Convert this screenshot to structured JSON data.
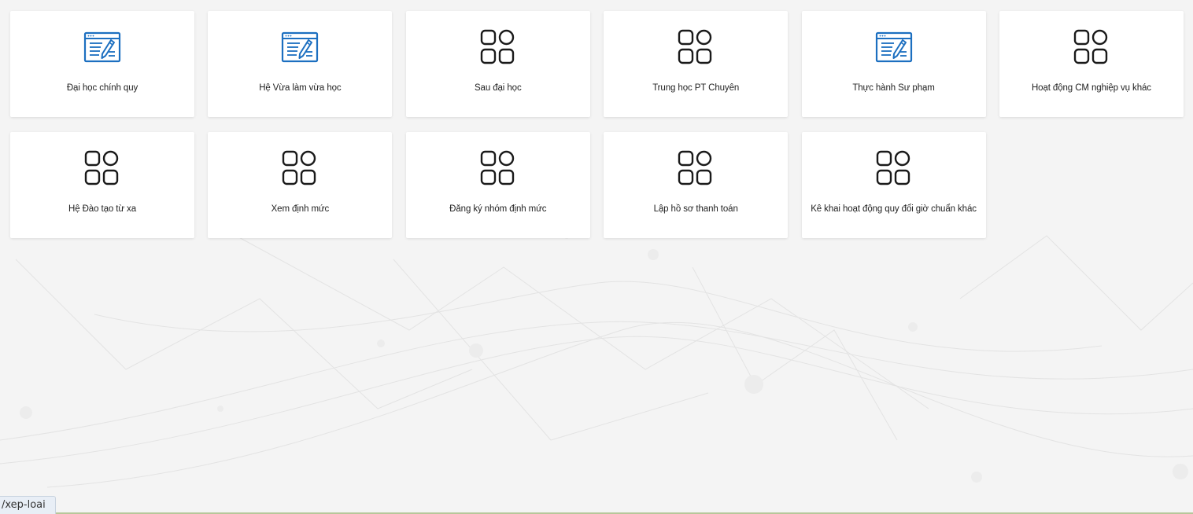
{
  "tiles": [
    {
      "label": "Đại học chính quy",
      "icon": "edit-document-icon"
    },
    {
      "label": "Hệ Vừa làm vừa học",
      "icon": "edit-document-icon"
    },
    {
      "label": "Sau đại học",
      "icon": "apps-grid-icon"
    },
    {
      "label": "Trung học PT Chuyên",
      "icon": "apps-grid-icon"
    },
    {
      "label": "Thực hành Sư phạm",
      "icon": "edit-document-icon"
    },
    {
      "label": "Hoạt động CM nghiệp vụ khác",
      "icon": "apps-grid-icon"
    },
    {
      "label": "Hệ Đào tạo từ xa",
      "icon": "apps-grid-icon"
    },
    {
      "label": "Xem định mức",
      "icon": "apps-grid-icon"
    },
    {
      "label": "Đăng ký nhóm định mức",
      "icon": "apps-grid-icon"
    },
    {
      "label": "Lập hồ sơ thanh toán",
      "icon": "apps-grid-icon"
    },
    {
      "label": "Kê khai hoạt động quy đổi giờ chuẩn khác",
      "icon": "apps-grid-icon"
    }
  ],
  "status_bar": {
    "url": "/xep-loai"
  },
  "colors": {
    "edit_icon": "#1c6fc0",
    "apps_icon": "#1a1a1a",
    "tile_background": "#ffffff",
    "page_background": "#f4f4f4"
  }
}
